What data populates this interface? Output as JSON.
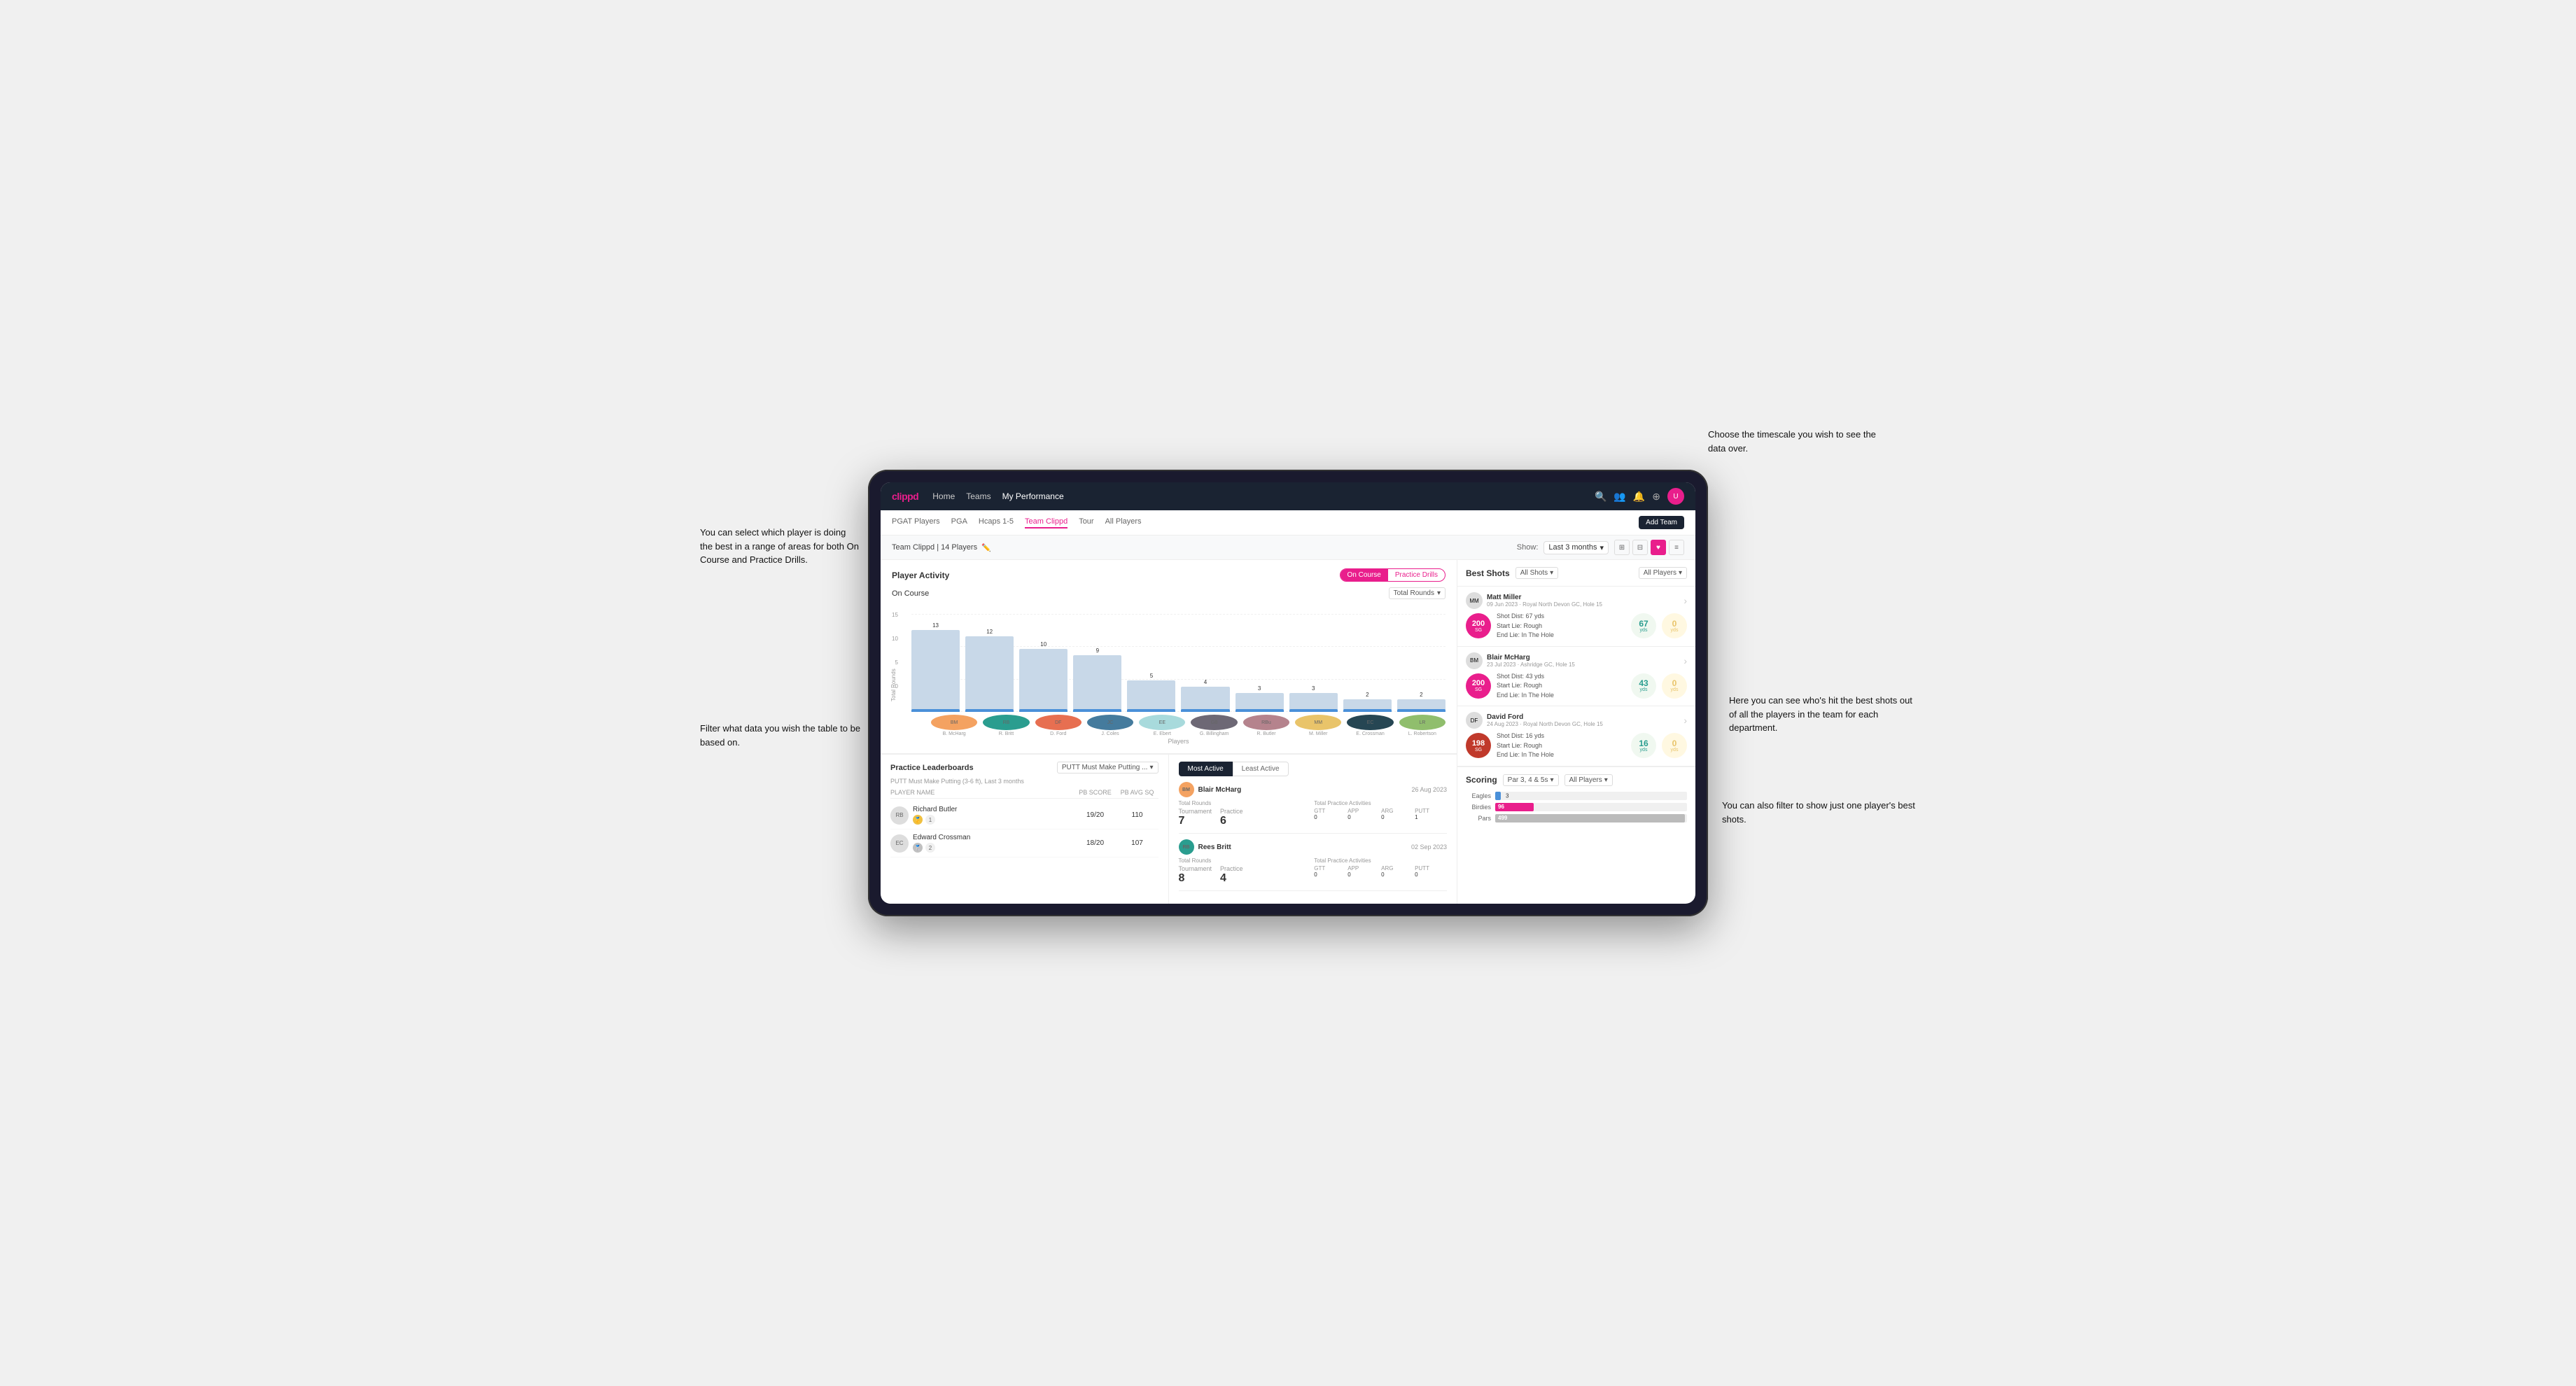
{
  "annotations": {
    "top_right": "Choose the timescale you wish to see the data over.",
    "left_top": "You can select which player is doing the best in a range of areas for both On Course and Practice Drills.",
    "left_bottom": "Filter what data you wish the table to be based on.",
    "right_middle": "Here you can see who's hit the best shots out of all the players in the team for each department.",
    "right_bottom": "You can also filter to show just one player's best shots."
  },
  "nav": {
    "logo": "clippd",
    "links": [
      "Home",
      "Teams",
      "My Performance"
    ],
    "add_team_label": "Add Team"
  },
  "sub_tabs": [
    "PGAT Players",
    "PGA",
    "Hcaps 1-5",
    "Team Clippd",
    "Tour",
    "All Players"
  ],
  "active_sub_tab": "Team Clippd",
  "team_header": {
    "team_name": "Team Clippd",
    "player_count": "14 Players",
    "show_label": "Show:",
    "timescale": "Last 3 months",
    "view_options": [
      "grid4",
      "grid2",
      "heart",
      "list"
    ]
  },
  "player_activity": {
    "title": "Player Activity",
    "toggle_on_course": "On Course",
    "toggle_practice": "Practice Drills",
    "chart_title": "On Course",
    "chart_filter": "Total Rounds",
    "y_labels": [
      "15",
      "10",
      "5",
      "0"
    ],
    "y_axis_title": "Total Rounds",
    "bars": [
      {
        "player": "B. McHarg",
        "value": 13,
        "initials": "BM",
        "color": "colored-1"
      },
      {
        "player": "R. Britt",
        "value": 12,
        "initials": "RB",
        "color": "colored-2"
      },
      {
        "player": "D. Ford",
        "value": 10,
        "initials": "DF",
        "color": "colored-3"
      },
      {
        "player": "J. Coles",
        "value": 9,
        "initials": "JC",
        "color": "colored-4"
      },
      {
        "player": "E. Ebert",
        "value": 5,
        "initials": "EE",
        "color": "colored-5"
      },
      {
        "player": "G. Billingham",
        "value": 4,
        "initials": "GB",
        "color": "colored-6"
      },
      {
        "player": "R. Butler",
        "value": 3,
        "initials": "RBu",
        "color": "colored-7"
      },
      {
        "player": "M. Miller",
        "value": 3,
        "initials": "MM",
        "color": "colored-8"
      },
      {
        "player": "E. Crossman",
        "value": 2,
        "initials": "EC",
        "color": "colored-9"
      },
      {
        "player": "L. Robertson",
        "value": 2,
        "initials": "LR",
        "color": "colored-10"
      }
    ],
    "x_label": "Players"
  },
  "practice_leaderboards": {
    "title": "Practice Leaderboards",
    "filter": "PUTT Must Make Putting ...",
    "subtitle": "PUTT Must Make Putting (3-6 ft), Last 3 months",
    "columns": [
      "PLAYER NAME",
      "PB SCORE",
      "PB AVG SQ"
    ],
    "rows": [
      {
        "rank": 1,
        "name": "Richard Butler",
        "pb_score": "19/20",
        "pb_avg_sq": "110",
        "avatar": "RB",
        "color": "colored-7"
      },
      {
        "rank": 2,
        "name": "Edward Crossman",
        "pb_score": "18/20",
        "pb_avg_sq": "107",
        "avatar": "EC",
        "color": "colored-9"
      }
    ]
  },
  "most_active": {
    "tabs": [
      "Most Active",
      "Least Active"
    ],
    "active_tab": "Most Active",
    "cards": [
      {
        "name": "Blair McHarg",
        "date": "26 Aug 2023",
        "total_rounds_label": "Total Rounds",
        "tournament": 7,
        "practice": 6,
        "total_practice_label": "Total Practice Activities",
        "gtt": 0,
        "app": 0,
        "arg": 0,
        "putt": 1,
        "avatar": "BM",
        "color": "colored-1"
      },
      {
        "name": "Rees Britt",
        "date": "02 Sep 2023",
        "total_rounds_label": "Total Rounds",
        "tournament": 8,
        "practice": 4,
        "total_practice_label": "Total Practice Activities",
        "gtt": 0,
        "app": 0,
        "arg": 0,
        "putt": 0,
        "avatar": "RB",
        "color": "colored-2"
      }
    ]
  },
  "best_shots": {
    "title": "Best Shots",
    "filter_shots": "All Shots",
    "filter_players": "All Players",
    "shots": [
      {
        "player_name": "Matt Miller",
        "player_meta": "09 Jun 2023 · Royal North Devon GC, Hole 15",
        "badge_number": "200",
        "badge_sub": "SG",
        "shot_dist": "67 yds",
        "start_lie": "Rough",
        "end_lie": "In The Hole",
        "dist_val": "67",
        "dist_unit": "yds",
        "zero_val": "0",
        "zero_unit": "yds",
        "avatar": "MM",
        "color": "colored-8"
      },
      {
        "player_name": "Blair McHarg",
        "player_meta": "23 Jul 2023 · Ashridge GC, Hole 15",
        "badge_number": "200",
        "badge_sub": "SG",
        "shot_dist": "43 yds",
        "start_lie": "Rough",
        "end_lie": "In The Hole",
        "dist_val": "43",
        "dist_unit": "yds",
        "zero_val": "0",
        "zero_unit": "yds",
        "avatar": "BM",
        "color": "colored-1"
      },
      {
        "player_name": "David Ford",
        "player_meta": "24 Aug 2023 · Royal North Devon GC, Hole 15",
        "badge_number": "198",
        "badge_sub": "SG",
        "shot_dist": "16 yds",
        "start_lie": "Rough",
        "end_lie": "In The Hole",
        "dist_val": "16",
        "dist_unit": "yds",
        "zero_val": "0",
        "zero_unit": "yds",
        "avatar": "DF",
        "color": "colored-3"
      }
    ]
  },
  "scoring": {
    "title": "Scoring",
    "filter_par": "Par 3, 4 & 5s",
    "filter_players": "All Players",
    "rows": [
      {
        "label": "Eagles",
        "value": 3,
        "max": 500,
        "color": "#4a90d9"
      },
      {
        "label": "Birdies",
        "value": 96,
        "max": 500,
        "color": "#e91e8c"
      },
      {
        "label": "Pars",
        "value": 499,
        "max": 500,
        "color": "#ccc"
      }
    ]
  }
}
